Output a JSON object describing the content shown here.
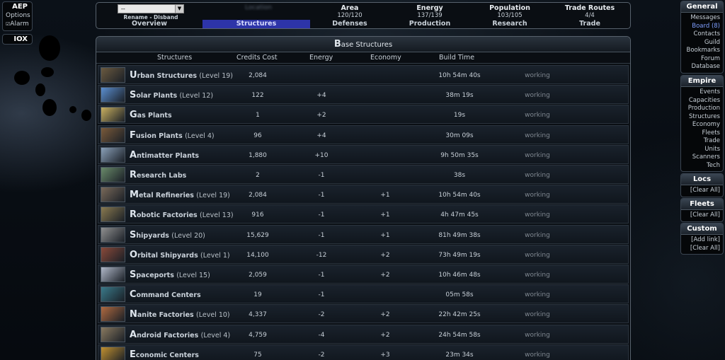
{
  "left": {
    "aep": {
      "title": "AEP",
      "options": "Options",
      "alarm": "Alarm"
    },
    "iox": {
      "title": "IOX"
    }
  },
  "topnav": {
    "select_value": "--",
    "rename_disband": "Rename - Disband",
    "location_blurred": "Location",
    "columns": [
      {
        "header": "",
        "value": "",
        "label": "Overview"
      },
      {
        "header": "",
        "value": "",
        "label": "Structures",
        "active": true
      },
      {
        "header": "Area",
        "value": "120/120",
        "label": "Defenses"
      },
      {
        "header": "Energy",
        "value": "137/139",
        "label": "Production"
      },
      {
        "header": "Population",
        "value": "103/105",
        "label": "Research"
      },
      {
        "header": "Trade Routes",
        "value": "4/4",
        "label": "Trade"
      }
    ]
  },
  "panel": {
    "title_cap": "B",
    "title_rest": "ase Structures",
    "headers": {
      "structures": "Structures",
      "cost": "Credits Cost",
      "energy": "Energy",
      "economy": "Economy",
      "time": "Build Time"
    },
    "rows": [
      {
        "cap": "U",
        "name": "rban Structures",
        "level": "(Level 19)",
        "cost": "2,084",
        "energy": "",
        "economy": "",
        "time": "10h 54m 40s",
        "status": "working",
        "color": "#6b5a40"
      },
      {
        "cap": "S",
        "name": "olar Plants",
        "level": "(Level 12)",
        "cost": "122",
        "energy": "+4",
        "economy": "",
        "time": "38m 19s",
        "status": "working",
        "color": "#5b8fd0"
      },
      {
        "cap": "G",
        "name": "as Plants",
        "level": "",
        "cost": "1",
        "energy": "+2",
        "economy": "",
        "time": "19s",
        "status": "working",
        "color": "#c9b060"
      },
      {
        "cap": "F",
        "name": "usion Plants",
        "level": "(Level 4)",
        "cost": "96",
        "energy": "+4",
        "economy": "",
        "time": "30m 09s",
        "status": "working",
        "color": "#7a5a3a"
      },
      {
        "cap": "A",
        "name": "ntimatter Plants",
        "level": "",
        "cost": "1,880",
        "energy": "+10",
        "economy": "",
        "time": "9h 50m 35s",
        "status": "working",
        "color": "#8aa0b8"
      },
      {
        "cap": "R",
        "name": "esearch Labs",
        "level": "",
        "cost": "2",
        "energy": "-1",
        "economy": "",
        "time": "38s",
        "status": "working",
        "color": "#6a8a6a"
      },
      {
        "cap": "M",
        "name": "etal Refineries",
        "level": "(Level 19)",
        "cost": "2,084",
        "energy": "-1",
        "economy": "+1",
        "time": "10h 54m 40s",
        "status": "working",
        "color": "#7a6a5a"
      },
      {
        "cap": "R",
        "name": "obotic Factories",
        "level": "(Level 13)",
        "cost": "916",
        "energy": "-1",
        "economy": "+1",
        "time": "4h 47m 45s",
        "status": "working",
        "color": "#8a7a50"
      },
      {
        "cap": "S",
        "name": "hipyards",
        "level": "(Level 20)",
        "cost": "15,629",
        "energy": "-1",
        "economy": "+1",
        "time": "81h 49m 38s",
        "status": "working",
        "color": "#909090"
      },
      {
        "cap": "O",
        "name": "rbital Shipyards",
        "level": "(Level 1)",
        "cost": "14,100",
        "energy": "-12",
        "economy": "+2",
        "time": "73h 49m 19s",
        "status": "working",
        "color": "#8a4a3a"
      },
      {
        "cap": "S",
        "name": "paceports",
        "level": "(Level 15)",
        "cost": "2,059",
        "energy": "-1",
        "economy": "+2",
        "time": "10h 46m 48s",
        "status": "working",
        "color": "#b0b8c8"
      },
      {
        "cap": "C",
        "name": "ommand Centers",
        "level": "",
        "cost": "19",
        "energy": "-1",
        "economy": "",
        "time": "05m 58s",
        "status": "working",
        "color": "#3a7a8a"
      },
      {
        "cap": "N",
        "name": "anite Factories",
        "level": "(Level 10)",
        "cost": "4,337",
        "energy": "-2",
        "economy": "+2",
        "time": "22h 42m 25s",
        "status": "working",
        "color": "#b06a40"
      },
      {
        "cap": "A",
        "name": "ndroid Factories",
        "level": "(Level 4)",
        "cost": "4,759",
        "energy": "-4",
        "economy": "+2",
        "time": "24h 54m 58s",
        "status": "working",
        "color": "#8a7a60"
      },
      {
        "cap": "E",
        "name": "conomic Centers",
        "level": "",
        "cost": "75",
        "energy": "-2",
        "economy": "+3",
        "time": "23m 34s",
        "status": "working",
        "color": "#c09030"
      }
    ]
  },
  "right": {
    "general": {
      "title": "General",
      "links": [
        "Messages",
        "Board (8)",
        "Contacts",
        "Guild",
        "Bookmarks",
        "Forum",
        "Database"
      ]
    },
    "empire": {
      "title": "Empire",
      "links": [
        "Events",
        "Capacities",
        "Production",
        "Structures",
        "Economy",
        "Fleets",
        "Trade",
        "Units",
        "Scanners",
        "Tech"
      ]
    },
    "locs": {
      "title": "Locs",
      "links": [
        "[Clear All]"
      ]
    },
    "fleets": {
      "title": "Fleets",
      "links": [
        "[Clear All]"
      ]
    },
    "custom": {
      "title": "Custom",
      "links": [
        "[Add link]",
        "[Clear All]"
      ]
    }
  }
}
